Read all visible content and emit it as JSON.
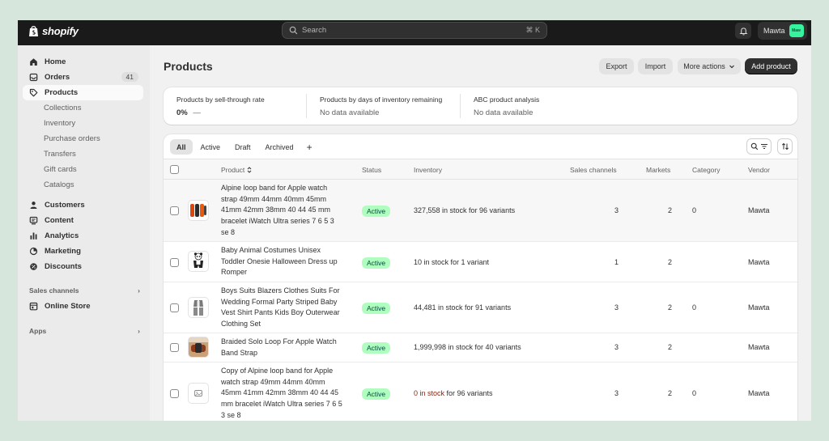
{
  "topbar": {
    "brand": "shopify",
    "search_placeholder": "Search",
    "search_shortcut": "⌘ K",
    "user_name": "Mawta",
    "user_badge": "Maw"
  },
  "sidebar": {
    "main_items": [
      {
        "label": "Home",
        "icon": "home-icon"
      },
      {
        "label": "Orders",
        "icon": "orders-icon",
        "count": "41"
      },
      {
        "label": "Products",
        "icon": "tag-icon",
        "active": true
      }
    ],
    "product_sub_items": [
      "Collections",
      "Inventory",
      "Purchase orders",
      "Transfers",
      "Gift cards",
      "Catalogs"
    ],
    "more_items": [
      {
        "label": "Customers",
        "icon": "person-icon"
      },
      {
        "label": "Content",
        "icon": "content-icon"
      },
      {
        "label": "Analytics",
        "icon": "analytics-icon"
      },
      {
        "label": "Marketing",
        "icon": "marketing-icon"
      },
      {
        "label": "Discounts",
        "icon": "discount-icon"
      }
    ],
    "sales_channels_label": "Sales channels",
    "online_store_label": "Online Store",
    "apps_label": "Apps"
  },
  "page": {
    "title": "Products",
    "buttons": {
      "export": "Export",
      "import": "Import",
      "more_actions": "More actions",
      "add_product": "Add product"
    }
  },
  "analytics": [
    {
      "label": "Products by sell-through rate",
      "value": "0%",
      "extra": "—"
    },
    {
      "label": "Products by days of inventory remaining",
      "value": "No data available"
    },
    {
      "label": "ABC product analysis",
      "value": "No data available"
    }
  ],
  "tabs": [
    "All",
    "Active",
    "Draft",
    "Archived",
    "+"
  ],
  "columns": {
    "product": "Product",
    "status": "Status",
    "inventory": "Inventory",
    "sales_channels": "Sales channels",
    "markets": "Markets",
    "category": "Category",
    "vendor": "Vendor"
  },
  "rows": [
    {
      "name": "Alpine loop band for Apple watch strap 49mm 44mm 40mm 45mm 41mm 42mm 38mm 40 44 45 mm bracelet iWatch Ultra series 7 6 5 3 se 8",
      "status": "Active",
      "inventory_prefix": "",
      "inventory_main": "327,558 in stock for 96 variants",
      "sales_channels": "3",
      "markets": "2",
      "category": "0",
      "vendor": "Mawta",
      "thumb": "watch-bands"
    },
    {
      "name": "Baby Animal Costumes Unisex Toddler Onesie Halloween Dress up Romper",
      "status": "Active",
      "inventory_prefix": "",
      "inventory_main": "10 in stock for 1 variant",
      "sales_channels": "1",
      "markets": "2",
      "category": "",
      "vendor": "Mawta",
      "thumb": "panda-onesie"
    },
    {
      "name": "Boys Suits Blazers Clothes Suits For Wedding Formal Party Striped Baby Vest Shirt Pants Kids Boy Outerwear Clothing Set",
      "status": "Active",
      "inventory_prefix": "",
      "inventory_main": "44,481 in stock for 91 variants",
      "sales_channels": "3",
      "markets": "2",
      "category": "0",
      "vendor": "Mawta",
      "thumb": "boys-suit"
    },
    {
      "name": "Braided Solo Loop For Apple Watch Band Strap",
      "status": "Active",
      "inventory_prefix": "",
      "inventory_main": "1,999,998 in stock for 40 variants",
      "sales_channels": "3",
      "markets": "2",
      "category": "",
      "vendor": "Mawta",
      "thumb": "braided-loop"
    },
    {
      "name": "Copy of Alpine loop band for Apple watch strap 49mm 44mm 40mm 45mm 41mm 42mm 38mm 40 44 45 mm bracelet iWatch Ultra series 7 6 5 3 se 8",
      "status": "Active",
      "inventory_prefix": "0 in stock",
      "inventory_main": " for 96 variants",
      "sales_channels": "3",
      "markets": "2",
      "category": "0",
      "vendor": "Mawta",
      "thumb": "image-placeholder"
    }
  ]
}
